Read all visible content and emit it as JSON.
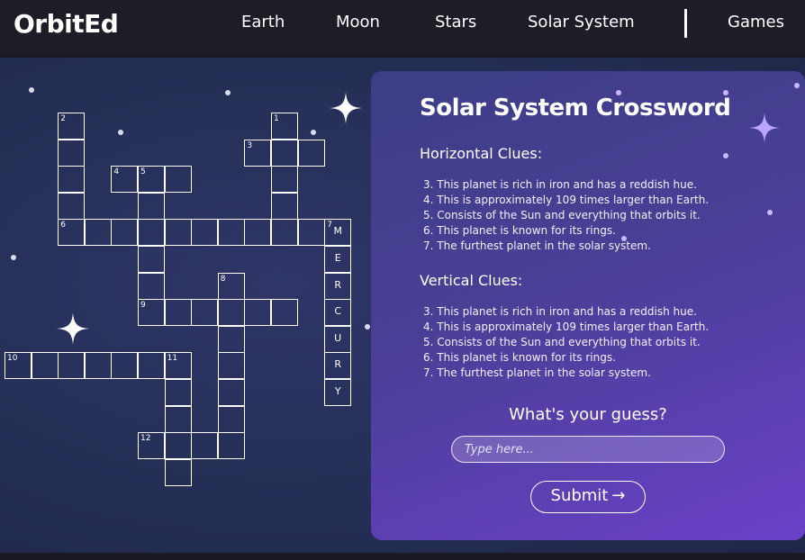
{
  "header": {
    "brand": "OrbitEd",
    "nav": [
      {
        "label": "Earth"
      },
      {
        "label": "Moon"
      },
      {
        "label": "Stars"
      },
      {
        "label": "Solar System"
      },
      {
        "label": "Games"
      }
    ]
  },
  "crossword": {
    "numbers": [
      "1",
      "2",
      "3",
      "4",
      "5",
      "6",
      "7",
      "8",
      "9",
      "10",
      "11",
      "12"
    ],
    "mercury_letters": [
      "M",
      "E",
      "R",
      "C",
      "U",
      "R",
      "Y"
    ]
  },
  "panel": {
    "title": "Solar System Crossword",
    "horizontal_heading": "Horizontal Clues:",
    "horizontal_clues": [
      "3. This planet is rich in iron and has a reddish hue.",
      "4. This is approximately 109 times larger than Earth.",
      "5. Consists of the Sun and everything that orbits it.",
      "6. This planet is known for its rings.",
      "7. The furthest planet in the solar system."
    ],
    "vertical_heading": "Vertical Clues:",
    "vertical_clues": [
      "3. This planet is rich in iron and has a reddish hue.",
      "4. This is approximately 109 times larger than Earth.",
      "5. Consists of the Sun and everything that orbits it.",
      "6. This planet is known for its rings.",
      "7. The furthest planet in the solar system."
    ],
    "guess_label": "What's your guess?",
    "guess_placeholder": "Type here...",
    "submit_label": "Submit",
    "submit_arrow": "→"
  }
}
